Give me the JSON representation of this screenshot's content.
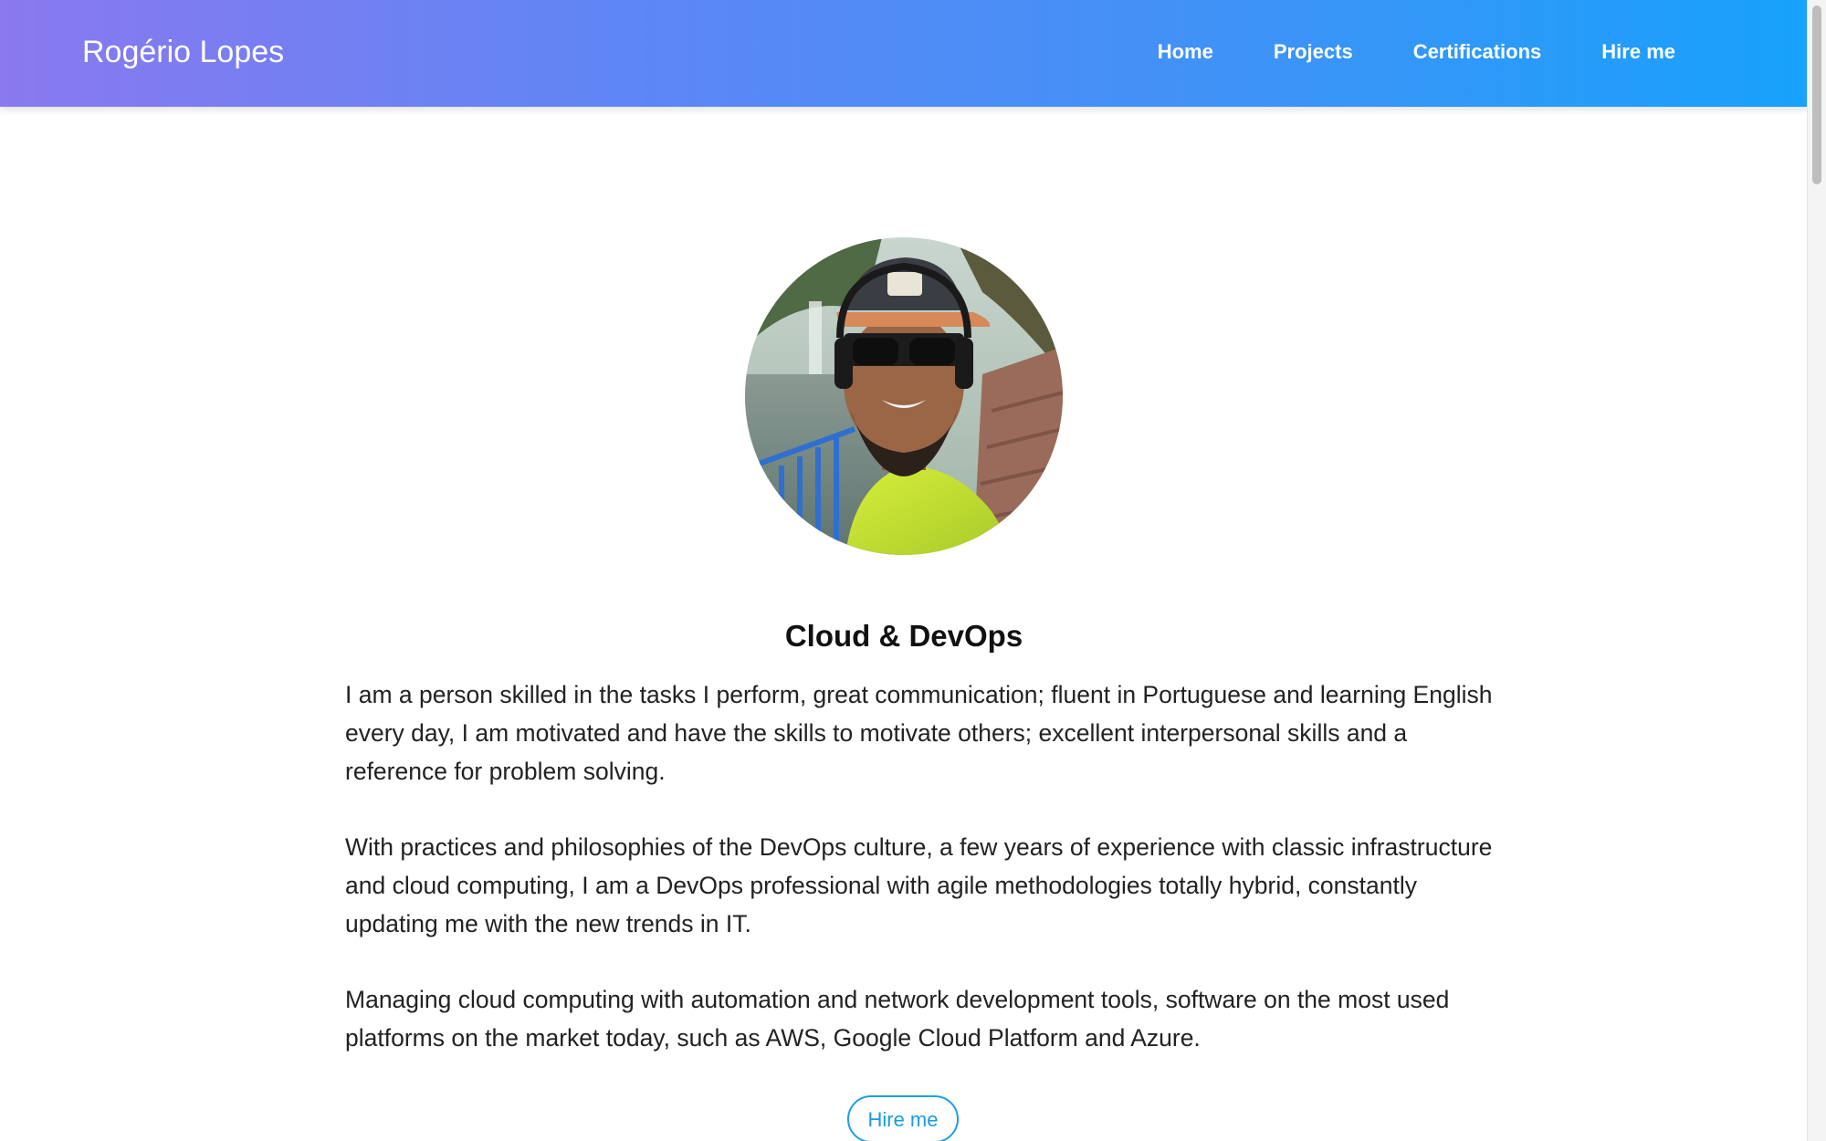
{
  "header": {
    "brand": "Rogério Lopes",
    "nav": [
      "Home",
      "Projects",
      "Certifications",
      "Hire me"
    ]
  },
  "profile": {
    "headline": "Cloud & DevOps",
    "paragraphs": [
      "I am a person skilled in the tasks I perform, great communication; fluent in Portuguese and learning English every day, I am motivated and have the skills to motivate others; excellent interpersonal skills and a reference for problem solving.",
      "With practices and philosophies of the DevOps culture, a few years of experience with classic infrastructure and cloud computing, I am a DevOps professional with agile methodologies totally hybrid, constantly updating me with the new trends in IT.",
      "Managing cloud computing with automation and network development tools, software on the most used platforms on the market today, such as AWS, Google Cloud Platform and Azure."
    ],
    "cta_label": "Hire me"
  },
  "colors": {
    "nav_gradient_start": "#8a79ef",
    "nav_gradient_end": "#17a2fb",
    "accent": "#1a9ae3"
  }
}
